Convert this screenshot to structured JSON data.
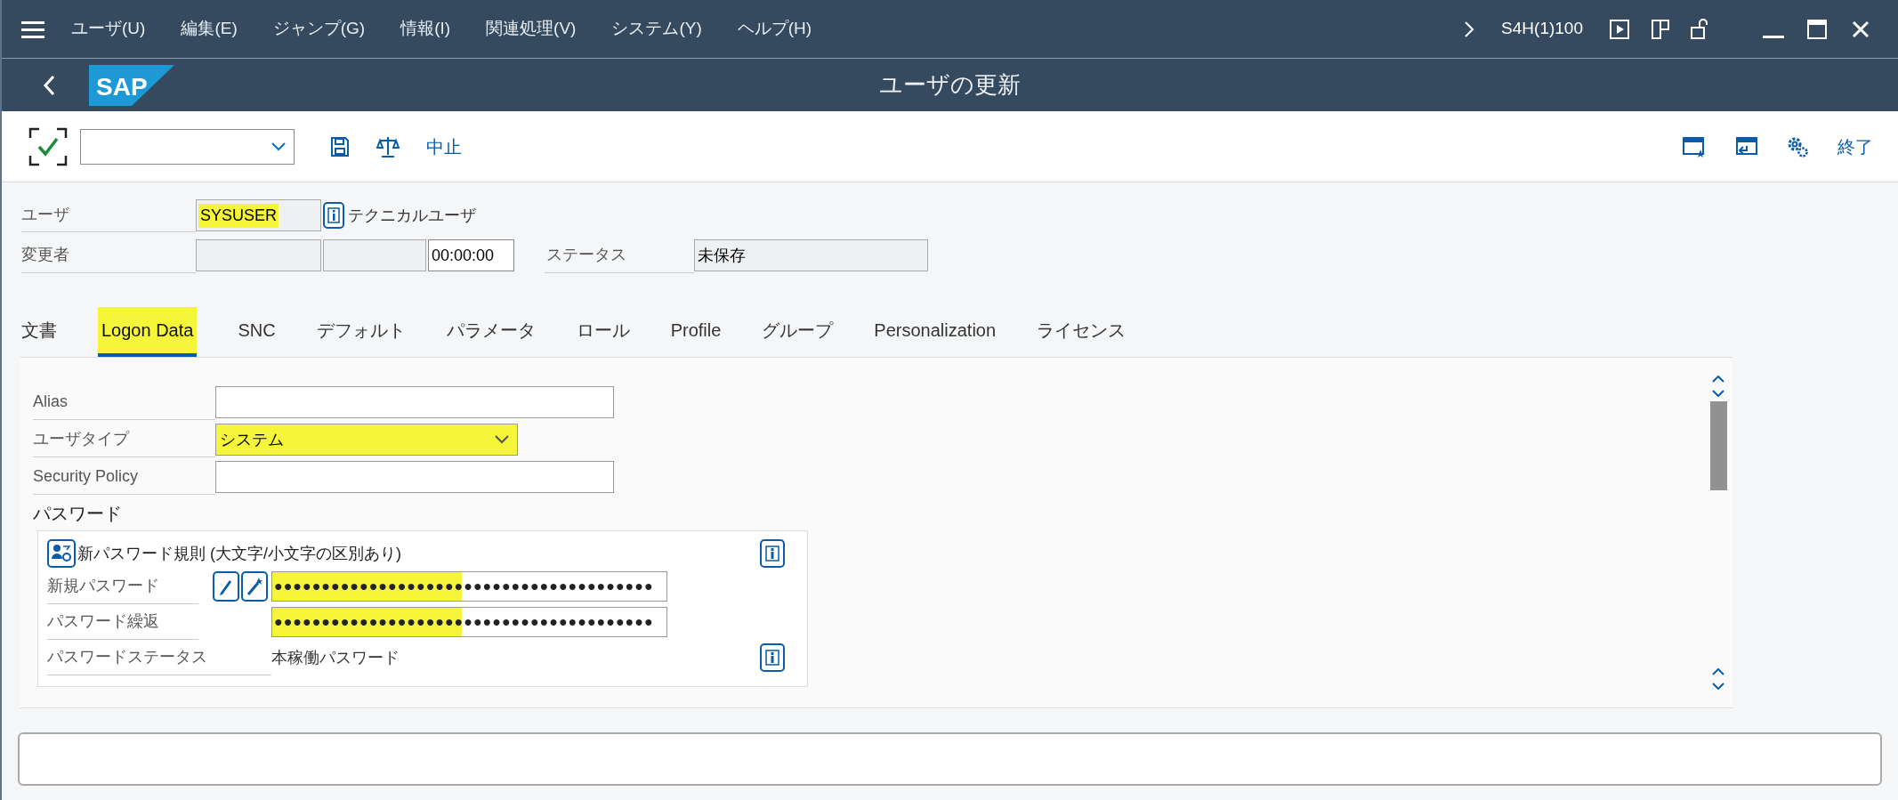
{
  "menu_bar": {
    "items": [
      "ユーザ(U)",
      "編集(E)",
      "ジャンプ(G)",
      "情報(I)",
      "関連処理(V)",
      "システム(Y)",
      "ヘルプ(H)"
    ],
    "system": "S4H(1)100"
  },
  "title_bar": {
    "logo": "SAP",
    "title": "ユーザの更新"
  },
  "toolbar": {
    "cancel": "中止",
    "exit": "終了"
  },
  "header": {
    "user": {
      "label": "ユーザ",
      "value": "SYSUSER",
      "highlighted": true,
      "note": "テクニカルユーザ"
    },
    "changed_by": {
      "label": "変更者",
      "time": "00:00:00"
    },
    "status": {
      "label": "ステータス",
      "value": "未保存"
    }
  },
  "tabs": [
    {
      "label": "文書",
      "selected": false,
      "highlighted": false
    },
    {
      "label": "Logon Data",
      "selected": true,
      "highlighted": true
    },
    {
      "label": "SNC",
      "selected": false,
      "highlighted": false
    },
    {
      "label": "デフォルト",
      "selected": false,
      "highlighted": false
    },
    {
      "label": "パラメータ",
      "selected": false,
      "highlighted": false
    },
    {
      "label": "ロール",
      "selected": false,
      "highlighted": false
    },
    {
      "label": "Profile",
      "selected": false,
      "highlighted": false
    },
    {
      "label": "グループ",
      "selected": false,
      "highlighted": false
    },
    {
      "label": "Personalization",
      "selected": false,
      "highlighted": false
    },
    {
      "label": "ライセンス",
      "selected": false,
      "highlighted": false
    }
  ],
  "logon_data": {
    "fields": [
      {
        "label": "Alias",
        "kind": "input",
        "highlighted": false
      },
      {
        "label": "ユーザタイプ",
        "kind": "dropdown",
        "value": "システム",
        "highlighted": true
      },
      {
        "label": "Security Policy",
        "kind": "input",
        "highlighted": false
      }
    ],
    "password": {
      "heading": "パスワード",
      "rule": "新パスワード規則 (大文字/小文字の区別あり)",
      "rows": [
        {
          "label": "新規パスワード",
          "kind": "password",
          "value": "●●●●●●●●●●●●●●●●●●●●●●●●●●●●●●●●●●●●●●●●",
          "tools": true,
          "highlighted": true
        },
        {
          "label": "パスワード繰返",
          "kind": "password",
          "value": "●●●●●●●●●●●●●●●●●●●●●●●●●●●●●●●●●●●●●●●●",
          "tools": false,
          "highlighted": true
        },
        {
          "label": "パスワードステータス",
          "kind": "text",
          "value": "本稼働パスワード",
          "tools": false,
          "highlighted": false
        }
      ]
    }
  }
}
